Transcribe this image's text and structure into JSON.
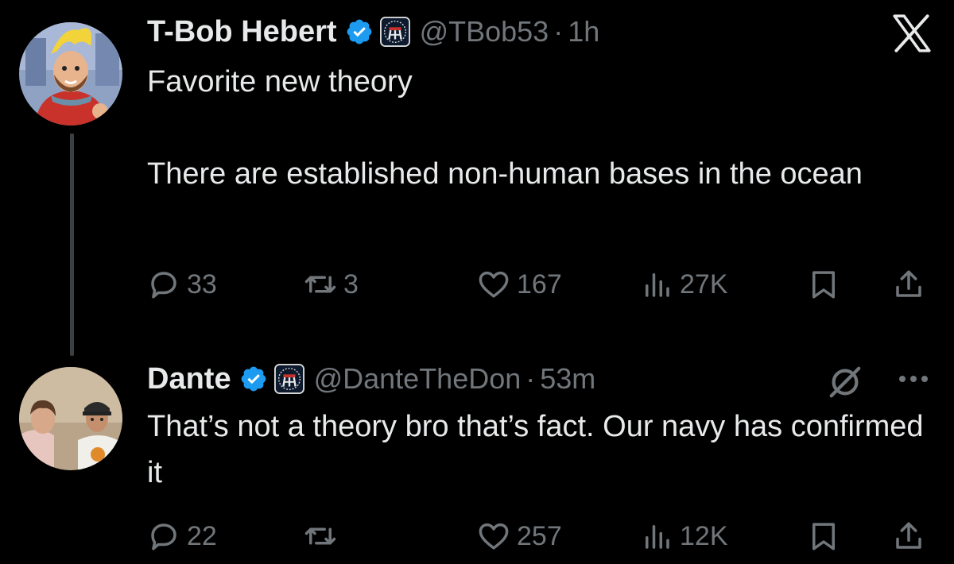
{
  "tweets": [
    {
      "author": {
        "display_name": "T-Bob Hebert",
        "handle": "@TBob53",
        "separator": "·",
        "time": "1h",
        "verified": true,
        "affiliate_badge": "barstool-badge"
      },
      "text": {
        "line1": "Favorite new theory",
        "line2": "There are established non-human bases in the ocean"
      },
      "actions": {
        "replies": "33",
        "reposts": "3",
        "likes": "167",
        "views": "27K"
      }
    },
    {
      "author": {
        "display_name": "Dante",
        "handle": "@DanteTheDon",
        "separator": "·",
        "time": "53m",
        "verified": true,
        "affiliate_badge": "barstool-badge"
      },
      "text": {
        "line1": "That’s not a theory bro that’s fact. Our navy has confirmed it"
      },
      "actions": {
        "replies": "22",
        "reposts": "",
        "likes": "257",
        "views": "12K"
      }
    }
  ],
  "icons": {
    "top_right": "x-logo-icon",
    "grok": "grok-icon",
    "more": "more-icon",
    "reply": "reply-icon",
    "repost": "repost-icon",
    "like": "heart-icon",
    "views": "views-icon",
    "bookmark": "bookmark-icon",
    "share": "share-icon"
  },
  "colors": {
    "background": "#000000",
    "text_primary": "#e7e9ea",
    "text_secondary": "#71767b",
    "verified_blue": "#1d9bf0",
    "thread_line": "#3b3f43"
  }
}
